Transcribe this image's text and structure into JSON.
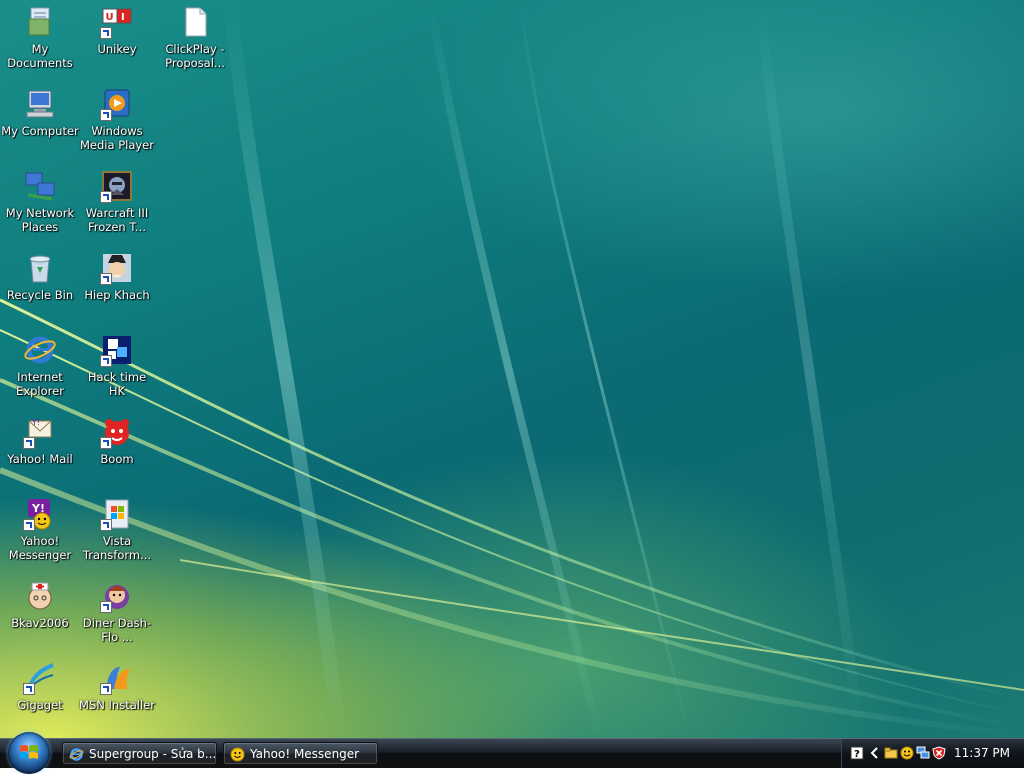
{
  "desktop": {
    "icons": [
      {
        "label": "My Documents",
        "kind": "folder-icon"
      },
      {
        "label": "Unikey",
        "kind": "unikey-icon"
      },
      {
        "label": "ClickPlay - Proposal...",
        "kind": "document-icon"
      },
      {
        "label": "My Computer",
        "kind": "computer-icon"
      },
      {
        "label": "Windows Media Player",
        "kind": "media-player-icon"
      },
      {
        "label": "My Network Places",
        "kind": "network-icon"
      },
      {
        "label": "Warcraft III Frozen T...",
        "kind": "game-icon"
      },
      {
        "label": "Recycle Bin",
        "kind": "recycle-bin-icon"
      },
      {
        "label": "Hiep Khach",
        "kind": "game-character-icon"
      },
      {
        "label": "Internet Explorer",
        "kind": "internet-explorer-icon"
      },
      {
        "label": "Hack time HK",
        "kind": "cube-icon"
      },
      {
        "label": "Yahoo! Mail",
        "kind": "mail-icon"
      },
      {
        "label": "Boom",
        "kind": "boom-icon"
      },
      {
        "label": "Yahoo! Messenger",
        "kind": "yahoo-messenger-icon"
      },
      {
        "label": "Vista Transform...",
        "kind": "vista-icon"
      },
      {
        "label": "Bkav2006",
        "kind": "antivirus-icon"
      },
      {
        "label": "Diner Dash-Flo ...",
        "kind": "diner-icon"
      },
      {
        "label": "Gigaget",
        "kind": "download-icon"
      },
      {
        "label": "MSN Installer",
        "kind": "msn-icon"
      }
    ]
  },
  "taskbar": {
    "start_label": "Start",
    "buttons": [
      {
        "label": "Supergroup - Sửa b...",
        "icon": "internet-explorer-icon"
      },
      {
        "label": "Yahoo! Messenger",
        "icon": "yahoo-smiley-icon"
      }
    ],
    "tray": {
      "icons": [
        "help-icon",
        "chevron-left-icon",
        "folder-sync-icon",
        "yahoo-smiley-icon",
        "network-icon",
        "security-alert-icon"
      ],
      "clock": "11:37 PM"
    }
  },
  "colors": {
    "desktop_teal": "#0f7d7e",
    "desktop_yellow": "#e6ee5a",
    "taskbar": "#111111",
    "label_text": "#ffffff"
  }
}
